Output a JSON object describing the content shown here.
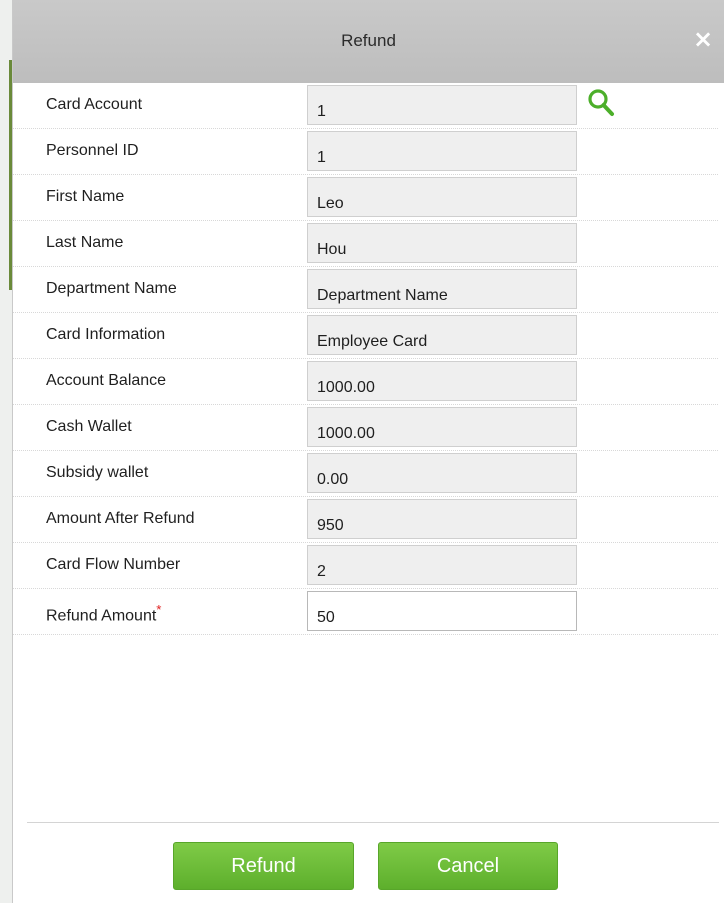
{
  "dialog": {
    "title": "Refund",
    "close_glyph": "×"
  },
  "fields": [
    {
      "label": "Card Account",
      "value": "1"
    },
    {
      "label": "Personnel ID",
      "value": "1"
    },
    {
      "label": "First Name",
      "value": "Leo"
    },
    {
      "label": "Last Name",
      "value": "Hou"
    },
    {
      "label": "Department Name",
      "value": "Department Name"
    },
    {
      "label": "Card Information",
      "value": "Employee Card"
    },
    {
      "label": "Account Balance",
      "value": "1000.00"
    },
    {
      "label": "Cash Wallet",
      "value": "1000.00"
    },
    {
      "label": "Subsidy wallet",
      "value": "0.00"
    },
    {
      "label": "Amount After Refund",
      "value": "950"
    },
    {
      "label": "Card Flow Number",
      "value": "2"
    },
    {
      "label": "Refund Amount",
      "value": "50",
      "required_mark": "*"
    }
  ],
  "buttons": {
    "refund_label": "Refund",
    "cancel_label": "Cancel"
  },
  "icons": {
    "search": "search-icon",
    "close": "close-icon"
  },
  "colors": {
    "accent_green": "#5daf2c",
    "required_red": "#e02020",
    "titlebar_gray": "#c4c4c4"
  }
}
